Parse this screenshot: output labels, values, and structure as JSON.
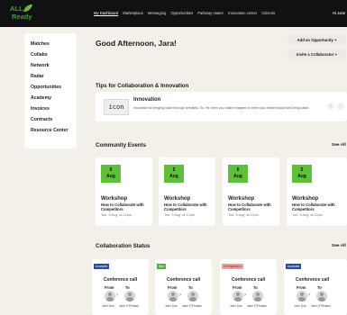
{
  "brand": {
    "line1": "ALL",
    "line2": "Ready"
  },
  "nav": [
    "My Dashboard",
    "Marketplace",
    "Messaging",
    "Opportunities",
    "Pathway maker",
    "Innovation center",
    "Citizens"
  ],
  "user": "Hi Jara!",
  "sidebar": [
    "Matches",
    "Collabs",
    "Network",
    "Radar",
    "Opportunities",
    "Academy",
    "Invoices",
    "Contracts",
    "Resource Center"
  ],
  "greeting": "Good Afternoon, Jara!",
  "buttons": {
    "add_opportunity": "Add an Opportunity +",
    "invite": "Invite a Collaborator +"
  },
  "tips": {
    "section_title": "Tips for Collaboration & Innovation",
    "icon_label": "icon",
    "title": "Innovation",
    "text": "Innovation is bringing value through creativity. So, it's when you make it happen is when you create impact and bring value."
  },
  "events": {
    "section_title": "Community Events",
    "see_all": "See All",
    "items": [
      {
        "day": "5",
        "month": "Aug",
        "title": "Workshop",
        "subtitle": "How to Collaborate with Competitors",
        "time": "Tue, 5 Aug, at 12pm"
      },
      {
        "day": "5",
        "month": "Aug",
        "title": "Workshop",
        "subtitle": "How to Collaborate with Competitors",
        "time": "Tue, 5 Aug, at 12pm"
      },
      {
        "day": "5",
        "month": "Aug",
        "title": "Workshop",
        "subtitle": "How to Collaborate with Competitors",
        "time": "Tue, 5 Aug, at 12pm"
      },
      {
        "day": "5",
        "month": "Aug",
        "title": "Workshop",
        "subtitle": "How to Collaborate with Competitors",
        "time": "Tue, 5 Aug, at 12pm"
      }
    ]
  },
  "collab": {
    "section_title": "Collaboration Status",
    "see_all": "See All",
    "items": [
      {
        "status": "Accepted",
        "status_color": "#2a4a9a",
        "title": "Conference call",
        "from": "From",
        "to": "To",
        "from_name": "John Doe",
        "to_name": "Jane O'Pertach"
      },
      {
        "status": "New",
        "status_color": "#4fb23a",
        "title": "Conference call",
        "from": "From",
        "to": "To",
        "from_name": "John Doe",
        "to_name": "Jane O'Pertach"
      },
      {
        "status": "In Negotiation",
        "status_color": "#e8a3a3",
        "title": "Conference call",
        "from": "From",
        "to": "To",
        "from_name": "John Doe",
        "to_name": "Jane O'Pertach"
      },
      {
        "status": "Accepted",
        "status_color": "#2a4a9a",
        "title": "Conference call",
        "from": "From",
        "to": "To",
        "from_name": "John Doe",
        "to_name": "Jane O'Pertach"
      }
    ]
  }
}
